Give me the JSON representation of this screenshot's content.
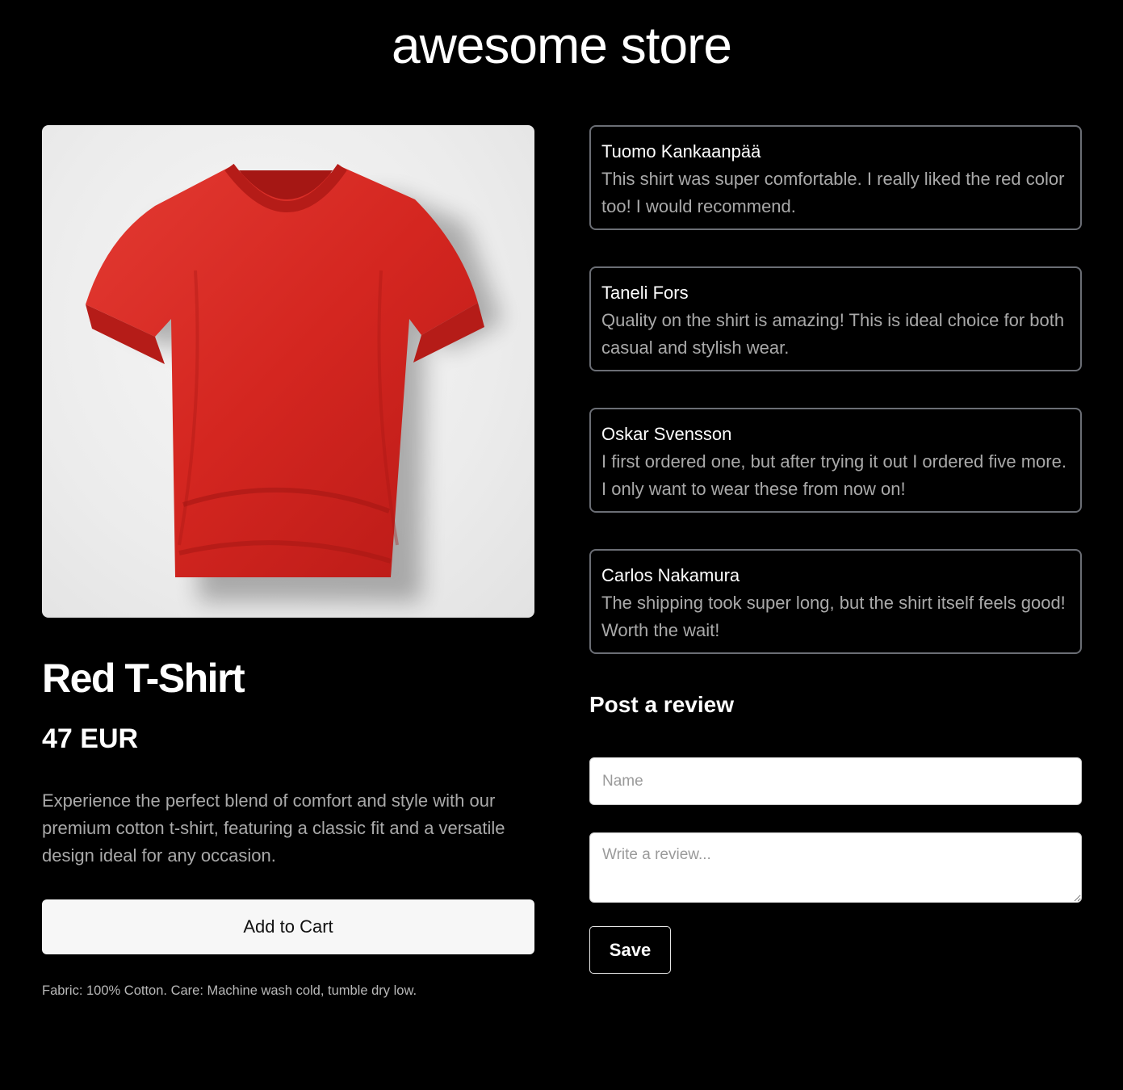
{
  "store": {
    "title": "awesome store"
  },
  "product": {
    "image_alt": "Red T-Shirt",
    "name": "Red T-Shirt",
    "price": "47 EUR",
    "description": "Experience the perfect blend of comfort and style with our premium cotton t-shirt, featuring a classic fit and a versatile design ideal for any occasion.",
    "add_to_cart_label": "Add to Cart",
    "fabric_note": "Fabric: 100% Cotton. Care: Machine wash cold, tumble dry low.",
    "color": "#d9201f"
  },
  "reviews": [
    {
      "name": "Tuomo Kankaanpää",
      "text": "This shirt was super comfortable. I really liked the red color too! I would recommend."
    },
    {
      "name": "Taneli Fors",
      "text": "Quality on the shirt is amazing! This is ideal choice for both casual and stylish wear."
    },
    {
      "name": "Oskar Svensson",
      "text": "I first ordered one, but after trying it out I ordered five more. I only want to wear these from now on!"
    },
    {
      "name": "Carlos Nakamura",
      "text": "The shipping took super long, but the shirt itself feels good! Worth the wait!"
    }
  ],
  "review_form": {
    "title": "Post a review",
    "name_placeholder": "Name",
    "name_value": "",
    "review_placeholder": "Write a review...",
    "review_value": "",
    "save_label": "Save"
  }
}
